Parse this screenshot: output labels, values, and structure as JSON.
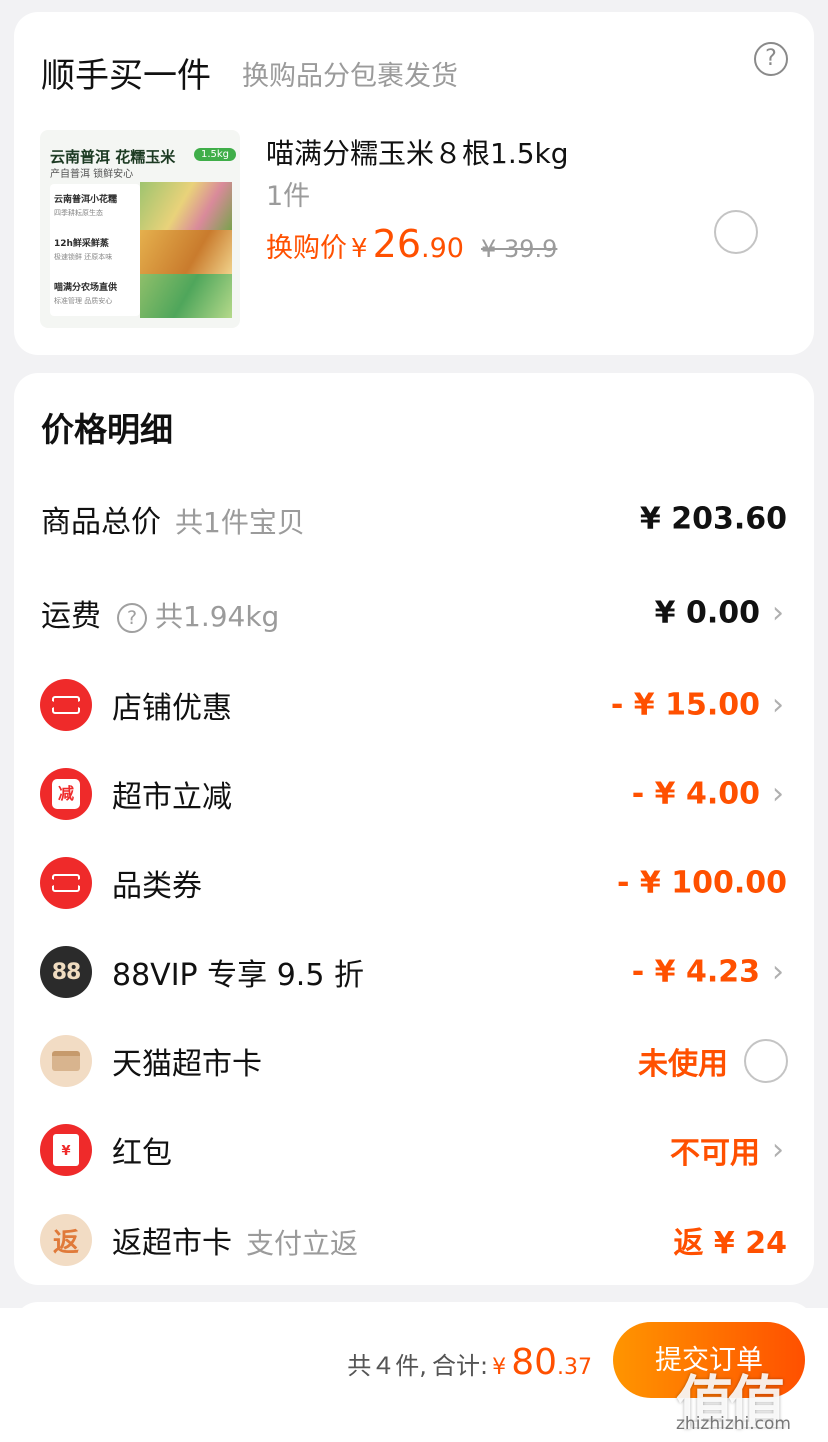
{
  "addon": {
    "title": "顺手买一件",
    "subtitle": "换购品分包裹发货",
    "help_glyph": "?",
    "image": {
      "headline": "云南普洱 花糯玉米",
      "tag": "1.5kg",
      "line2": "产自普洱 锁鲜安心",
      "points": [
        {
          "title": "云南普洱小花糯",
          "desc": "四季耕耘原生态"
        },
        {
          "title": "12h鲜采鲜蒸",
          "desc": "极速锁鲜 还原本味"
        },
        {
          "title": "喵满分农场直供",
          "desc": "标准管理 品质安心"
        }
      ]
    },
    "item_name": "喵满分糯玉米８根1.5kg",
    "qty": "1件",
    "price_label": "换购价",
    "price_symbol": "¥",
    "price_int": "26",
    "price_dec": ".90",
    "original_price": "¥ 39.9"
  },
  "detail": {
    "title": "价格明细",
    "goods_total": {
      "label": "商品总价",
      "hint": "共1件宝贝",
      "value": "¥ 203.60"
    },
    "shipping": {
      "label": "运费",
      "help_glyph": "?",
      "hint": "共1.94kg",
      "value": "¥ 0.00"
    },
    "discounts": [
      {
        "icon": "coupon-icon",
        "label": "店铺优惠",
        "value": "- ¥ 15.00",
        "chevron": true
      },
      {
        "icon": "reduce-icon",
        "icon_text": "减",
        "label": "超市立减",
        "value": "- ¥ 4.00",
        "chevron": true
      },
      {
        "icon": "coupon-icon",
        "label": "品类券",
        "value": "- ¥ 100.00",
        "chevron": false
      },
      {
        "icon": "vip-88-icon",
        "icon_text": "88",
        "label": "88VIP 专享 9.5 折",
        "value": "- ¥ 4.23",
        "chevron": true
      }
    ],
    "tmall_card": {
      "icon": "card-icon",
      "label": "天猫超市卡",
      "value": "未使用"
    },
    "red_packet": {
      "icon": "red-packet-icon",
      "icon_text": "¥",
      "label": "红包",
      "value": "不可用"
    },
    "cashback": {
      "icon": "cashback-icon",
      "icon_text": "返",
      "label": "返超市卡",
      "hint": "支付立返",
      "value": "返 ¥ 24"
    }
  },
  "bottom": {
    "count": "共４件,",
    "total_label": "合计:",
    "total_symbol": "¥",
    "total_int": "80",
    "total_dec": ".37",
    "submit_label": "提交订单"
  },
  "watermark": {
    "logo": "值值值",
    "domain": "zhizhizhi.com"
  },
  "chevron_glyph": "›",
  "colors": {
    "accent": "#ff5000",
    "button_gradient": [
      "#ff9500",
      "#ff5000"
    ],
    "icon_red": "#ef2a2a"
  }
}
